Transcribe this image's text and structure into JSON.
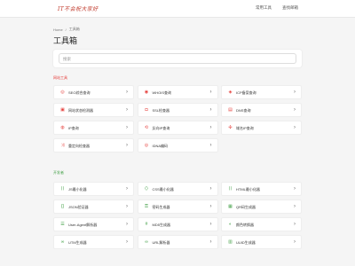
{
  "header": {
    "logo_text": "IT不会祝大家好",
    "nav": [
      "常用工具",
      "查找邮箱"
    ]
  },
  "breadcrumb": {
    "home": "Home",
    "separator": "/",
    "current": "工具箱"
  },
  "page_title": "工具箱",
  "search": {
    "placeholder": "搜索",
    "value": ""
  },
  "sections": [
    {
      "label": "网站工具",
      "color": "#e53935",
      "items": [
        {
          "label": "SEO综合查询",
          "icon": "globe-icon"
        },
        {
          "label": "WHOIS查询",
          "icon": "user-icon"
        },
        {
          "label": "ICP备案查询",
          "icon": "shield-icon"
        },
        {
          "label": "网站状态检测器",
          "icon": "monitor-icon"
        },
        {
          "label": "SSL检查器",
          "icon": "lock-icon"
        },
        {
          "label": "DNS查询",
          "icon": "server-icon"
        },
        {
          "label": "IP查询",
          "icon": "ip-icon"
        },
        {
          "label": "反向IP查询",
          "icon": "reverse-icon"
        },
        {
          "label": "域名IP查询",
          "icon": "network-icon"
        },
        {
          "label": "重定向检查器",
          "icon": "redirect-icon"
        },
        {
          "label": "IDNA编码",
          "icon": "globe-icon"
        }
      ]
    },
    {
      "label": "开发者",
      "color": "#43a047",
      "items": [
        {
          "label": "JS最小化器",
          "icon": "code-icon"
        },
        {
          "label": "CSS最小化器",
          "icon": "code-icon"
        },
        {
          "label": "HTML最小化器",
          "icon": "code-icon"
        },
        {
          "label": "JSON验证器",
          "icon": "braces-icon"
        },
        {
          "label": "密码生成器",
          "icon": "key-icon"
        },
        {
          "label": "QR码生成器",
          "icon": "qr-icon"
        },
        {
          "label": "User-Agent解析器",
          "icon": "agent-icon"
        },
        {
          "label": "MD5生成器",
          "icon": "hash-icon"
        },
        {
          "label": "颜色转换器",
          "icon": "palette-icon"
        },
        {
          "label": "UTM生成器",
          "icon": "link-icon"
        },
        {
          "label": "URL解析器",
          "icon": "link-icon"
        },
        {
          "label": "UUID生成器",
          "icon": "id-icon"
        }
      ]
    }
  ]
}
